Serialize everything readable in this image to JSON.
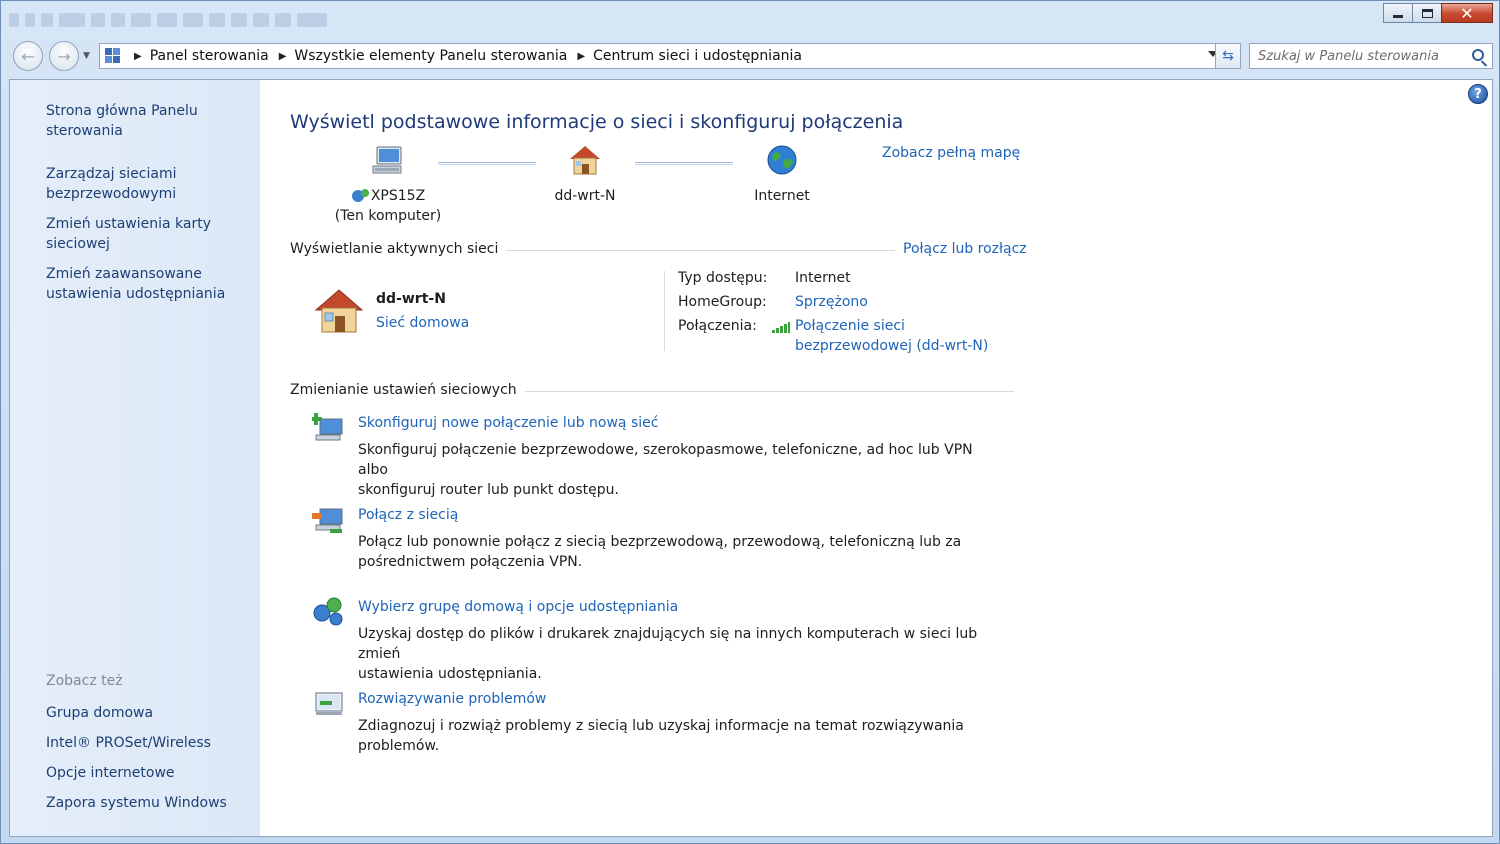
{
  "breadcrumb": [
    "Panel sterowania",
    "Wszystkie elementy Panelu sterowania",
    "Centrum sieci i udostępniania"
  ],
  "search": {
    "placeholder": "Szukaj w Panelu sterowania"
  },
  "help_label": "?",
  "sidebar": {
    "links": [
      "Strona główna Panelu sterowania",
      "Zarządzaj sieciami bezprzewodowymi",
      "Zmień ustawienia karty sieciowej",
      "Zmień zaawansowane ustawienia udostępniania"
    ],
    "see_also_label": "Zobacz też",
    "see_also": [
      "Grupa domowa",
      "Intel® PROSet/Wireless",
      "Opcje internetowe",
      "Zapora systemu Windows"
    ]
  },
  "main": {
    "title": "Wyświetl podstawowe informacje o sieci i skonfiguruj połączenia",
    "map": {
      "computer_name": "XPS15Z",
      "computer_sub": "(Ten komputer)",
      "router": "dd-wrt-N",
      "internet": "Internet",
      "full_map_link": "Zobacz pełną mapę"
    },
    "active": {
      "heading": "Wyświetlanie aktywnych sieci",
      "connect_link": "Połącz lub rozłącz",
      "network_name": "dd-wrt-N",
      "network_type": "Sieć domowa",
      "access_type_label": "Typ dostępu:",
      "access_type_value": "Internet",
      "homegroup_label": "HomeGroup:",
      "homegroup_value": "Sprzężono",
      "connections_label": "Połączenia:",
      "connections_value_line1": "Połączenie sieci",
      "connections_value_line2": "bezprzewodowej (dd-wrt-N)"
    },
    "change": {
      "heading": "Zmienianie ustawień sieciowych",
      "tasks": [
        {
          "title": "Skonfiguruj nowe połączenie lub nową sieć",
          "desc1": "Skonfiguruj połączenie bezprzewodowe, szerokopasmowe, telefoniczne, ad hoc lub VPN albo",
          "desc2": "skonfiguruj router lub punkt dostępu."
        },
        {
          "title": "Połącz z siecią",
          "desc1": "Połącz lub ponownie połącz z siecią bezprzewodową, przewodową, telefoniczną lub za",
          "desc2": "pośrednictwem połączenia VPN."
        },
        {
          "title": "Wybierz grupę domową i opcje udostępniania",
          "desc1": "Uzyskaj dostęp do plików i drukarek znajdujących się na innych komputerach w sieci lub zmień",
          "desc2": "ustawienia udostępniania."
        },
        {
          "title": "Rozwiązywanie problemów",
          "desc1": "Zdiagnozuj i rozwiąż problemy z siecią lub uzyskaj informacje na temat rozwiązywania",
          "desc2": "problemów."
        }
      ]
    }
  }
}
